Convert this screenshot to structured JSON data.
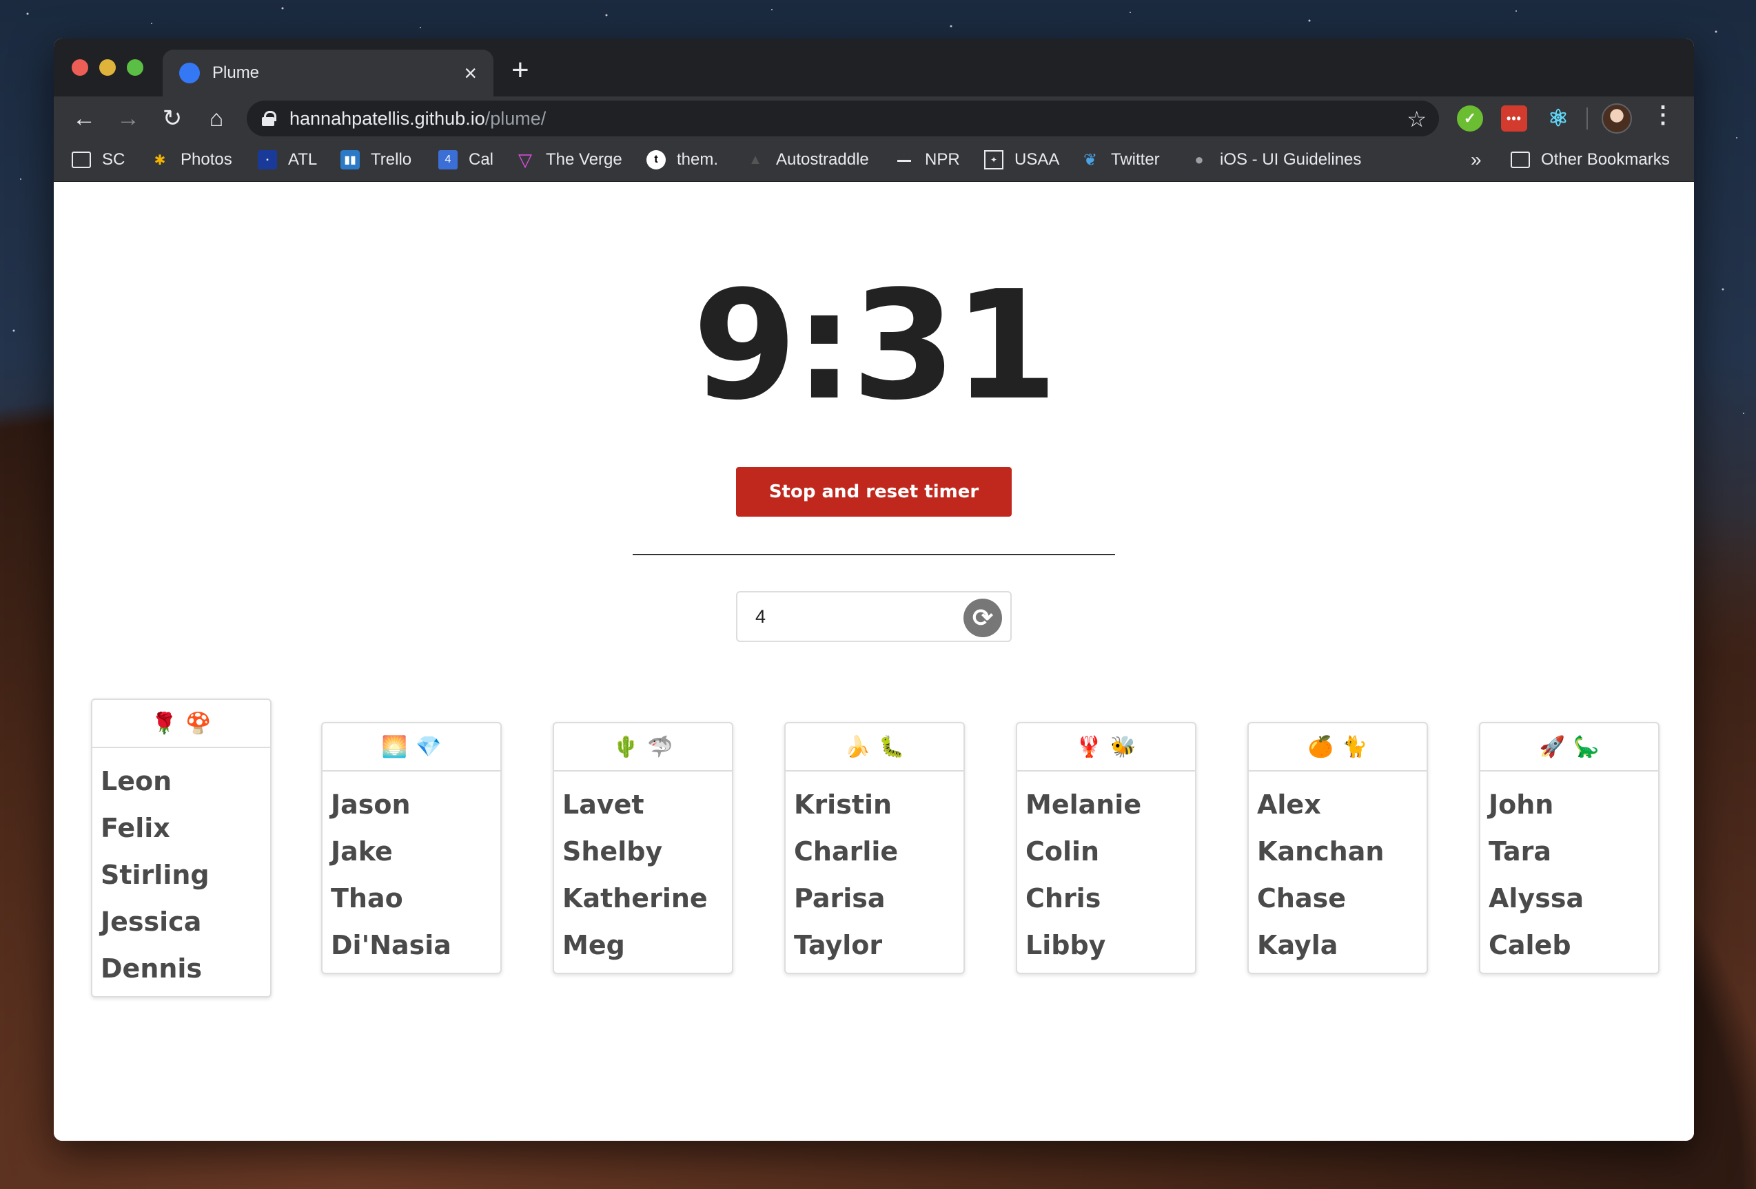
{
  "browser": {
    "tab_title": "Plume",
    "url_host": "hannahpatellis.github.io",
    "url_path": "/plume/",
    "bookmarks": [
      {
        "label": "SC",
        "icon": "folder-icon"
      },
      {
        "label": "Photos",
        "icon": "photos-icon"
      },
      {
        "label": "ATL",
        "icon": "weather-icon"
      },
      {
        "label": "Trello",
        "icon": "trello-icon"
      },
      {
        "label": "Cal",
        "icon": "calendar-icon"
      },
      {
        "label": "The Verge",
        "icon": "verge-icon"
      },
      {
        "label": "them.",
        "icon": "them-icon"
      },
      {
        "label": "Autostraddle",
        "icon": "autostraddle-icon"
      },
      {
        "label": "NPR",
        "icon": "npr-icon"
      },
      {
        "label": "USAA",
        "icon": "usaa-icon"
      },
      {
        "label": "Twitter",
        "icon": "twitter-icon"
      },
      {
        "label": "iOS - UI Guidelines",
        "icon": "apple-icon"
      }
    ],
    "overflow": "»",
    "other_bookmarks": "Other Bookmarks"
  },
  "timer": {
    "display": "9:31",
    "stop_label": "Stop and reset timer"
  },
  "group_size": {
    "value": "4"
  },
  "groups": [
    {
      "emoji": [
        "🌹",
        "🍄"
      ],
      "members": [
        "Leon",
        "Felix",
        "Stirling",
        "Jessica",
        "Dennis"
      ]
    },
    {
      "emoji": [
        "🌅",
        "💎"
      ],
      "members": [
        "Jason",
        "Jake",
        "Thao",
        "Di'Nasia"
      ]
    },
    {
      "emoji": [
        "🌵",
        "🦈"
      ],
      "members": [
        "Lavet",
        "Shelby",
        "Katherine",
        "Meg"
      ]
    },
    {
      "emoji": [
        "🍌",
        "🐛"
      ],
      "members": [
        "Kristin",
        "Charlie",
        "Parisa",
        "Taylor"
      ]
    },
    {
      "emoji": [
        "🦞",
        "🐝"
      ],
      "members": [
        "Melanie",
        "Colin",
        "Chris",
        "Libby"
      ]
    },
    {
      "emoji": [
        "🍊",
        "🐈"
      ],
      "members": [
        "Alex",
        "Kanchan",
        "Chase",
        "Kayla"
      ]
    },
    {
      "emoji": [
        "🚀",
        "🦕"
      ],
      "members": [
        "John",
        "Tara",
        "Alyssa",
        "Caleb"
      ]
    }
  ],
  "colors": {
    "accent": "#c0281e",
    "text": "#222222"
  }
}
